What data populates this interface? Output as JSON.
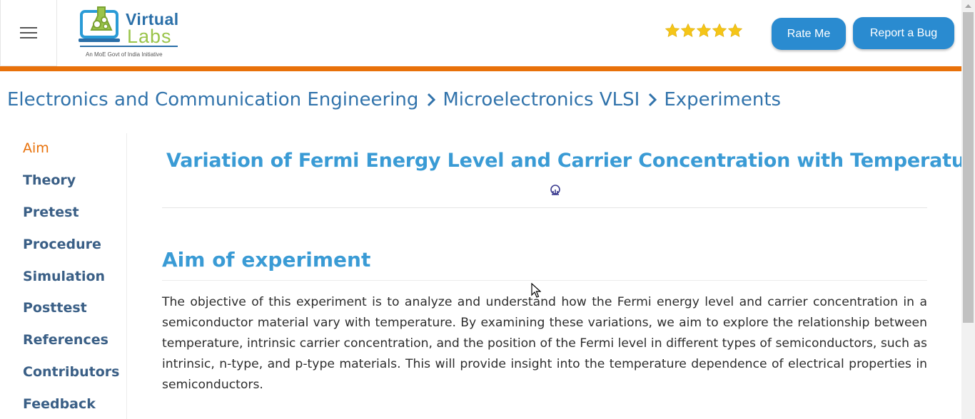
{
  "header": {
    "menu_icon": "hamburger-menu-icon",
    "logo": {
      "word1": "Virtual",
      "word2": "Labs",
      "tagline": "An MoE Govt of India Initiative"
    },
    "rating": {
      "stars_filled": 5,
      "stars_total": 5,
      "star_color": "#f5c518"
    },
    "rate_me_label": "Rate Me",
    "report_bug_label": "Report a Bug"
  },
  "colors": {
    "accent_orange": "#e8710a",
    "button_blue": "#2a8bd0",
    "heading_blue": "#3a9bd5",
    "breadcrumb_blue": "#3173ab"
  },
  "breadcrumb": [
    {
      "label": "Electronics and Communication Engineering"
    },
    {
      "label": "Microelectronics VLSI"
    },
    {
      "label": "Experiments"
    }
  ],
  "sidebar": {
    "items": [
      {
        "label": "Aim",
        "active": true
      },
      {
        "label": "Theory"
      },
      {
        "label": "Pretest"
      },
      {
        "label": "Procedure"
      },
      {
        "label": "Simulation"
      },
      {
        "label": "Posttest"
      },
      {
        "label": "References"
      },
      {
        "label": "Contributors"
      },
      {
        "label": "Feedback"
      }
    ]
  },
  "main": {
    "title": "Variation of Fermi Energy Level and Carrier Concentration with Temperature",
    "institute_icon": "institute-logo-icon",
    "aim_heading": "Aim of experiment",
    "aim_text": "The objective of this experiment is to analyze and understand how the Fermi energy level and carrier concentration in a semiconductor material vary with temperature. By examining these variations, we aim to explore the relationship between temperature, intrinsic carrier concentration, and the position of the Fermi level in different types of semiconductors, such as intrinsic, n-type, and p-type materials. This will provide insight into the temperature dependence of electrical properties in semiconductors."
  }
}
